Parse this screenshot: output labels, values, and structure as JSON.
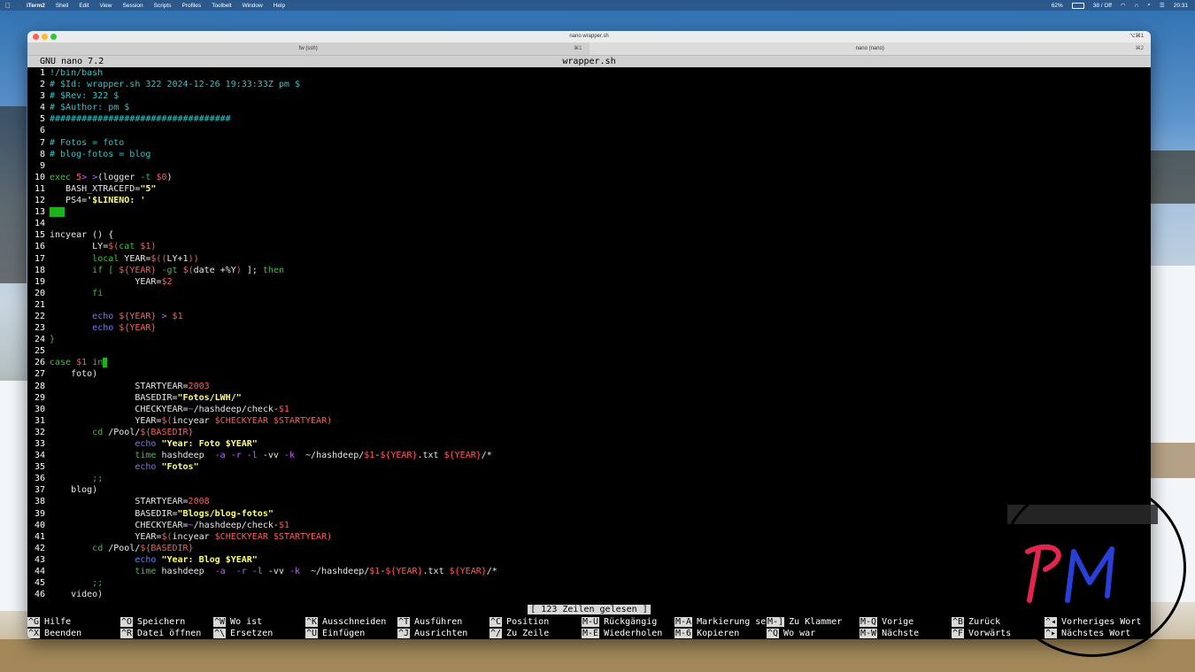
{
  "menubar": {
    "app": "iTerm2",
    "items": [
      "Shell",
      "Edit",
      "View",
      "Session",
      "Scripts",
      "Profiles",
      "Toolbelt",
      "Window",
      "Help"
    ],
    "battery": "62%",
    "status": "38 / Off",
    "time": "20:31"
  },
  "window": {
    "title": "nano wrapper.sh",
    "title_shortcut": "⌥⌘1",
    "tabs": [
      {
        "label": "fw (ssh)",
        "key": "⌘1"
      },
      {
        "label": "nano (nano)",
        "key": "⌘2"
      }
    ]
  },
  "nano": {
    "version": "GNU nano 7.2",
    "filename": "wrapper.sh",
    "status_message": "[ 123 Zeilen gelesen ]"
  },
  "code_lines": [
    {
      "n": "1",
      "seg": [
        [
          "c-comment",
          "!/bin/bash"
        ]
      ]
    },
    {
      "n": "2",
      "seg": [
        [
          "c-comment",
          "# $Id: wrapper.sh 322 2024-12-26 19:33:33Z pm $"
        ]
      ]
    },
    {
      "n": "3",
      "seg": [
        [
          "c-comment",
          "# $Rev: 322 $"
        ]
      ]
    },
    {
      "n": "4",
      "seg": [
        [
          "c-comment",
          "# $Author: pm $"
        ]
      ]
    },
    {
      "n": "5",
      "seg": [
        [
          "c-comment",
          "##################################"
        ]
      ]
    },
    {
      "n": "6",
      "seg": []
    },
    {
      "n": "7",
      "seg": [
        [
          "c-comment",
          "# Fotos = foto"
        ]
      ]
    },
    {
      "n": "8",
      "seg": [
        [
          "c-comment",
          "# blog-fotos = blog"
        ]
      ]
    },
    {
      "n": "9",
      "seg": []
    },
    {
      "n": "10",
      "seg": [
        [
          "c-kw",
          "exec"
        ],
        [
          "c-plain",
          " "
        ],
        [
          "c-var",
          "5"
        ],
        [
          "c-op",
          "> >"
        ],
        [
          "c-plain",
          "(logger "
        ],
        [
          "c-kw",
          "-t"
        ],
        [
          "c-plain",
          " "
        ],
        [
          "c-var",
          "$0"
        ],
        [
          "c-plain",
          ")"
        ]
      ]
    },
    {
      "n": "11",
      "seg": [
        [
          "c-plain",
          "   BASH_XTRACEFD="
        ],
        [
          "c-str",
          "\"5\""
        ]
      ]
    },
    {
      "n": "12",
      "seg": [
        [
          "c-plain",
          "   PS4="
        ],
        [
          "c-str",
          "'$LINENO: '"
        ]
      ]
    },
    {
      "n": "13",
      "seg": [],
      "cursor": "block"
    },
    {
      "n": "14",
      "seg": []
    },
    {
      "n": "15",
      "seg": [
        [
          "c-plain",
          "incyear () {"
        ]
      ]
    },
    {
      "n": "16",
      "seg": [
        [
          "c-plain",
          "        LY="
        ],
        [
          "c-var",
          "$("
        ],
        [
          "c-kw",
          "cat"
        ],
        [
          "c-plain",
          " "
        ],
        [
          "c-var",
          "$1)"
        ]
      ]
    },
    {
      "n": "17",
      "seg": [
        [
          "c-plain",
          "        "
        ],
        [
          "c-kw",
          "local"
        ],
        [
          "c-plain",
          " YEAR="
        ],
        [
          "c-var",
          "$(("
        ],
        [
          "c-plain",
          "LY+1"
        ],
        [
          "c-var",
          "))"
        ]
      ]
    },
    {
      "n": "18",
      "seg": [
        [
          "c-plain",
          "        "
        ],
        [
          "c-kw",
          "if [ "
        ],
        [
          "c-var",
          "${YEAR}"
        ],
        [
          "c-plain",
          " "
        ],
        [
          "c-kw",
          "-gt"
        ],
        [
          "c-plain",
          " "
        ],
        [
          "c-var",
          "$("
        ],
        [
          "c-plain",
          "date +%Y"
        ],
        [
          "c-var",
          ")"
        ],
        [
          "c-plain",
          " ]; "
        ],
        [
          "c-kw",
          "then"
        ]
      ]
    },
    {
      "n": "19",
      "seg": [
        [
          "c-plain",
          "                YEAR="
        ],
        [
          "c-var",
          "$2"
        ]
      ]
    },
    {
      "n": "20",
      "seg": [
        [
          "c-plain",
          "        "
        ],
        [
          "c-kw",
          "fi"
        ]
      ]
    },
    {
      "n": "21",
      "seg": []
    },
    {
      "n": "22",
      "seg": [
        [
          "c-plain",
          "        "
        ],
        [
          "c-cmd",
          "echo"
        ],
        [
          "c-plain",
          " "
        ],
        [
          "c-var",
          "${YEAR}"
        ],
        [
          "c-plain",
          " "
        ],
        [
          "c-op",
          ">"
        ],
        [
          "c-plain",
          " "
        ],
        [
          "c-var",
          "$1"
        ]
      ]
    },
    {
      "n": "23",
      "seg": [
        [
          "c-plain",
          "        "
        ],
        [
          "c-cmd",
          "echo"
        ],
        [
          "c-plain",
          " "
        ],
        [
          "c-var",
          "${YEAR}"
        ]
      ]
    },
    {
      "n": "24",
      "seg": [
        [
          "c-kw",
          "}"
        ]
      ]
    },
    {
      "n": "25",
      "seg": []
    },
    {
      "n": "26",
      "seg": [
        [
          "c-kw",
          "case"
        ],
        [
          "c-plain",
          " "
        ],
        [
          "c-var",
          "$1"
        ],
        [
          "c-plain",
          " "
        ],
        [
          "c-kw",
          "in"
        ]
      ],
      "cursor": "thin"
    },
    {
      "n": "27",
      "seg": [
        [
          "c-plain",
          "    foto)"
        ]
      ]
    },
    {
      "n": "28",
      "seg": [
        [
          "c-plain",
          "                STARTYEAR="
        ],
        [
          "c-var",
          "2003"
        ]
      ]
    },
    {
      "n": "29",
      "seg": [
        [
          "c-plain",
          "                BASEDIR="
        ],
        [
          "c-str",
          "\"Fotos/LWH/\""
        ]
      ]
    },
    {
      "n": "30",
      "seg": [
        [
          "c-plain",
          "                CHECKYEAR="
        ],
        [
          "c-op",
          "~"
        ],
        [
          "c-plain",
          "/hashdeep/check-"
        ],
        [
          "c-var",
          "$1"
        ]
      ]
    },
    {
      "n": "31",
      "seg": [
        [
          "c-plain",
          "                YEAR="
        ],
        [
          "c-var",
          "$("
        ],
        [
          "c-plain",
          "incyear "
        ],
        [
          "c-var",
          "$CHECKYEAR $STARTYEAR"
        ],
        [
          "c-var",
          ")"
        ]
      ]
    },
    {
      "n": "32",
      "seg": [
        [
          "c-plain",
          "        "
        ],
        [
          "c-kw",
          "cd"
        ],
        [
          "c-plain",
          " /Pool/"
        ],
        [
          "c-var",
          "${BASEDIR}"
        ]
      ]
    },
    {
      "n": "33",
      "seg": [
        [
          "c-plain",
          "                "
        ],
        [
          "c-cmd",
          "echo"
        ],
        [
          "c-plain",
          " "
        ],
        [
          "c-str",
          "\"Year: Foto $YEAR\""
        ]
      ]
    },
    {
      "n": "34",
      "seg": [
        [
          "c-plain",
          "                "
        ],
        [
          "c-kw",
          "time"
        ],
        [
          "c-plain",
          " hashdeep  "
        ],
        [
          "c-op",
          "-a -r -l"
        ],
        [
          "c-plain",
          " -vv "
        ],
        [
          "c-op",
          "-k"
        ],
        [
          "c-plain",
          "  ~/hashdeep/"
        ],
        [
          "c-var",
          "$1"
        ],
        [
          "c-plain",
          "-"
        ],
        [
          "c-var",
          "${YEAR}"
        ],
        [
          "c-plain",
          ".txt "
        ],
        [
          "c-var",
          "${YEAR}"
        ],
        [
          "c-plain",
          "/*"
        ]
      ]
    },
    {
      "n": "35",
      "seg": [
        [
          "c-plain",
          "                "
        ],
        [
          "c-cmd",
          "echo"
        ],
        [
          "c-plain",
          " "
        ],
        [
          "c-str",
          "\"Fotos\""
        ]
      ]
    },
    {
      "n": "36",
      "seg": [
        [
          "c-plain",
          "        "
        ],
        [
          "c-kw",
          ";;"
        ]
      ]
    },
    {
      "n": "37",
      "seg": [
        [
          "c-plain",
          "    blog)"
        ]
      ]
    },
    {
      "n": "38",
      "seg": [
        [
          "c-plain",
          "                STARTYEAR="
        ],
        [
          "c-var",
          "2008"
        ]
      ]
    },
    {
      "n": "39",
      "seg": [
        [
          "c-plain",
          "                BASEDIR="
        ],
        [
          "c-str",
          "\"Blogs/blog-fotos\""
        ]
      ]
    },
    {
      "n": "40",
      "seg": [
        [
          "c-plain",
          "                CHECKYEAR="
        ],
        [
          "c-op",
          "~"
        ],
        [
          "c-plain",
          "/hashdeep/check-"
        ],
        [
          "c-var",
          "$1"
        ]
      ]
    },
    {
      "n": "41",
      "seg": [
        [
          "c-plain",
          "                YEAR="
        ],
        [
          "c-var",
          "$("
        ],
        [
          "c-plain",
          "incyear "
        ],
        [
          "c-var",
          "$CHECKYEAR $STARTYEAR"
        ],
        [
          "c-var",
          ")"
        ]
      ]
    },
    {
      "n": "42",
      "seg": [
        [
          "c-plain",
          "        "
        ],
        [
          "c-kw",
          "cd"
        ],
        [
          "c-plain",
          " /Pool/"
        ],
        [
          "c-var",
          "${BASEDIR}"
        ]
      ]
    },
    {
      "n": "43",
      "seg": [
        [
          "c-plain",
          "                "
        ],
        [
          "c-cmd",
          "echo"
        ],
        [
          "c-plain",
          " "
        ],
        [
          "c-str",
          "\"Year: Blog $YEAR\""
        ]
      ]
    },
    {
      "n": "44",
      "seg": [
        [
          "c-plain",
          "                "
        ],
        [
          "c-kw",
          "time"
        ],
        [
          "c-plain",
          " hashdeep  "
        ],
        [
          "c-op",
          "-a  -r -l"
        ],
        [
          "c-plain",
          " -vv "
        ],
        [
          "c-op",
          "-k"
        ],
        [
          "c-plain",
          "  ~/hashdeep/"
        ],
        [
          "c-var",
          "$1"
        ],
        [
          "c-plain",
          "-"
        ],
        [
          "c-var",
          "${YEAR}"
        ],
        [
          "c-plain",
          ".txt "
        ],
        [
          "c-var",
          "${YEAR}"
        ],
        [
          "c-plain",
          "/*"
        ]
      ]
    },
    {
      "n": "45",
      "seg": [
        [
          "c-plain",
          "        "
        ],
        [
          "c-kw",
          ";;"
        ]
      ]
    },
    {
      "n": "46",
      "seg": [
        [
          "c-plain",
          "    video)"
        ]
      ]
    }
  ],
  "shortcuts": {
    "row1": [
      {
        "key": "^G",
        "label": "Hilfe"
      },
      {
        "key": "^O",
        "label": "Speichern"
      },
      {
        "key": "^W",
        "label": "Wo ist"
      },
      {
        "key": "^K",
        "label": "Ausschneiden"
      },
      {
        "key": "^T",
        "label": "Ausführen"
      },
      {
        "key": "^C",
        "label": "Position"
      },
      {
        "key": "M-U",
        "label": "Rückgängig"
      },
      {
        "key": "M-A",
        "label": "Markierung set"
      },
      {
        "key": "M-]",
        "label": "Zu Klammer"
      },
      {
        "key": "M-Q",
        "label": "Vorige"
      },
      {
        "key": "^B",
        "label": "Zurück"
      },
      {
        "key": "^◂",
        "label": "Vorheriges Wort"
      }
    ],
    "row2": [
      {
        "key": "^X",
        "label": "Beenden"
      },
      {
        "key": "^R",
        "label": "Datei öffnen"
      },
      {
        "key": "^\\",
        "label": "Ersetzen"
      },
      {
        "key": "^U",
        "label": "Einfügen"
      },
      {
        "key": "^J",
        "label": "Ausrichten"
      },
      {
        "key": "^/",
        "label": "Zu Zeile"
      },
      {
        "key": "M-E",
        "label": "Wiederholen"
      },
      {
        "key": "M-6",
        "label": "Kopieren"
      },
      {
        "key": "^Q",
        "label": "Wo war"
      },
      {
        "key": "M-W",
        "label": "Nächste"
      },
      {
        "key": "^F",
        "label": "Vorwärts"
      },
      {
        "key": "^▸",
        "label": "Nächstes Wort"
      }
    ]
  },
  "colors": {
    "comment": "#32c4c4",
    "keyword": "#3fbf3f",
    "variable": "#ff5a5a",
    "string": "#ffff6a",
    "command": "#6c7bff"
  }
}
